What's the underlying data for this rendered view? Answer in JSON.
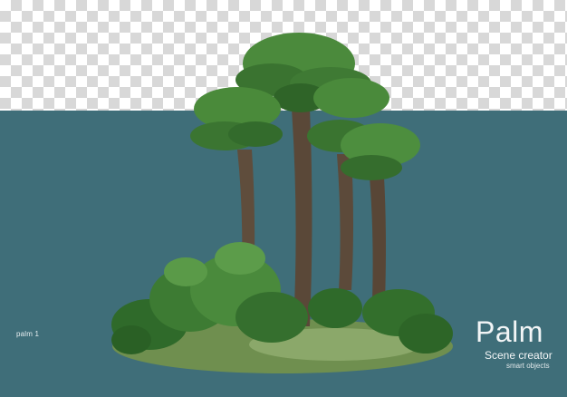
{
  "image": {
    "label": "palm 1",
    "brand": {
      "title": "Palm",
      "subtitle": "Scene creator",
      "tagline": "smart objects"
    }
  },
  "colors": {
    "background": "#3f6e79",
    "checker_light": "#ffffff",
    "checker_dark": "#d8d8d8",
    "foliage": "#2f6a2a",
    "trunk": "#5a4a3a",
    "ground": "#6f8f4f"
  },
  "icons": [
    "palm-tree-illustration"
  ]
}
